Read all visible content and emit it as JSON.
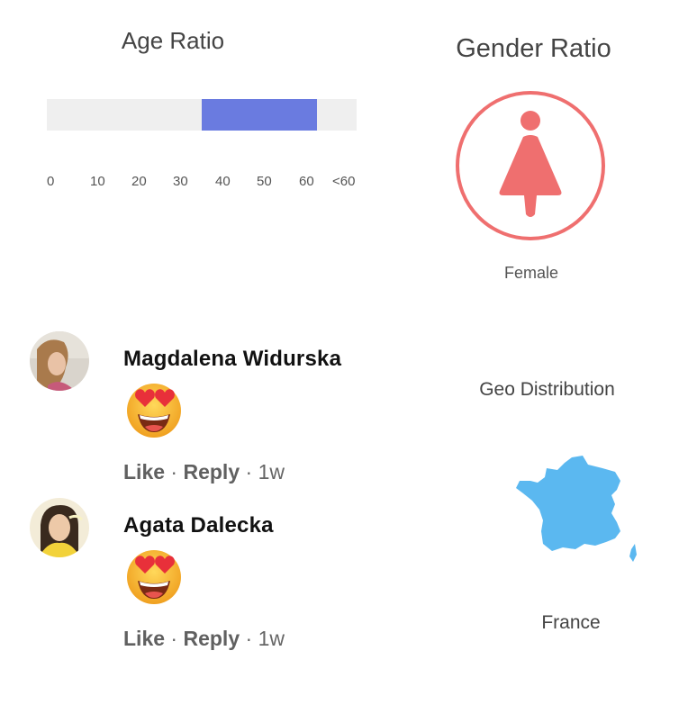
{
  "age_ratio": {
    "title": "Age Ratio",
    "range_start": 35,
    "range_end": 61,
    "axis_max": 70,
    "ticks": [
      "0",
      "10",
      "20",
      "30",
      "40",
      "50",
      "60",
      "<60"
    ],
    "fill_color": "#6a7be0"
  },
  "gender_ratio": {
    "title": "Gender Ratio",
    "label": "Female",
    "icon": "female-icon",
    "color": "#ef6f6f"
  },
  "comments": [
    {
      "name": "Magdalena Widurska",
      "reaction": "heart-eyes-emoji",
      "like": "Like",
      "reply": "Reply",
      "time": "1w"
    },
    {
      "name": "Agata Dalecka",
      "reaction": "heart-eyes-emoji",
      "like": "Like",
      "reply": "Reply",
      "time": "1w"
    }
  ],
  "geo_distribution": {
    "title": "Geo Distribution",
    "country": "France",
    "map_color": "#5bb8f0"
  }
}
